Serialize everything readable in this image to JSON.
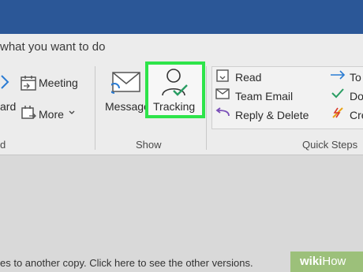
{
  "tell_me": {
    "text": "what you want to do"
  },
  "ribbon": {
    "respond_group": {
      "meeting_label": "Meeting",
      "forward_label": "ard",
      "more_label": "More",
      "group_label": "d"
    },
    "show_group": {
      "message_label": "Message",
      "tracking_label": "Tracking",
      "group_label": "Show"
    },
    "quick_steps": {
      "items": [
        "Read",
        "Team Email",
        "Reply & Delete"
      ],
      "side_items": [
        "To",
        "Do",
        "Cre"
      ],
      "group_label": "Quick Steps"
    }
  },
  "status": {
    "text": "es to another copy. Click here to see the other versions."
  },
  "watermark": {
    "brand": "wiki",
    "how": "How"
  },
  "colors": {
    "highlight": "#2ee44a",
    "titlebar": "#2b5797"
  },
  "icons": [
    "calendar-icon",
    "reply-arrow-icon",
    "more-icon",
    "envelope-icon",
    "person-check-icon",
    "read-icon",
    "team-email-icon",
    "reply-delete-icon",
    "to-arrow-icon",
    "check-icon",
    "create-icon"
  ]
}
